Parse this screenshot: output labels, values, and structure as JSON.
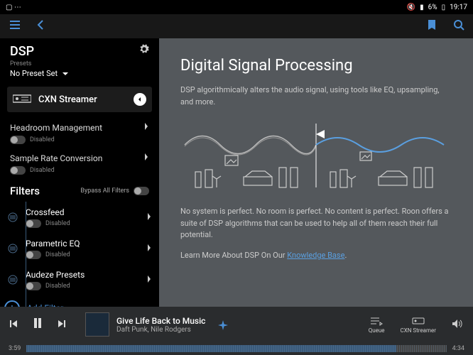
{
  "status": {
    "battery": "6%",
    "time": "19:17"
  },
  "sidebar": {
    "title": "DSP",
    "presets_label": "Presets",
    "preset_value": "No Preset Set",
    "device": "CXN Streamer",
    "settings": [
      {
        "label": "Headroom Management",
        "state": "Disabled"
      },
      {
        "label": "Sample Rate Conversion",
        "state": "Disabled"
      }
    ],
    "filters_title": "Filters",
    "bypass_label": "Bypass All Filters",
    "filters": [
      {
        "name": "Crossfeed",
        "state": "Disabled"
      },
      {
        "name": "Parametric EQ",
        "state": "Disabled"
      },
      {
        "name": "Audeze Presets",
        "state": "Disabled"
      }
    ],
    "add_filter": "Add Filter"
  },
  "content": {
    "heading": "Digital Signal Processing",
    "p1": "DSP algorithmically alters the audio signal, using tools like EQ, upsampling, and more.",
    "p2": "No system is perfect. No room is perfect. No content is perfect. Roon offers a suite of DSP algorithms that can be used to help all of them reach their full potential.",
    "learn_prefix": "Learn More About DSP On Our ",
    "learn_link": "Knowledge Base"
  },
  "player": {
    "title": "Give Life Back to Music",
    "artist": "Daft Punk, Nile Rodgers",
    "queue_label": "Queue",
    "output_label": "CXN Streamer",
    "pos": "3:59",
    "dur": "4:34"
  }
}
